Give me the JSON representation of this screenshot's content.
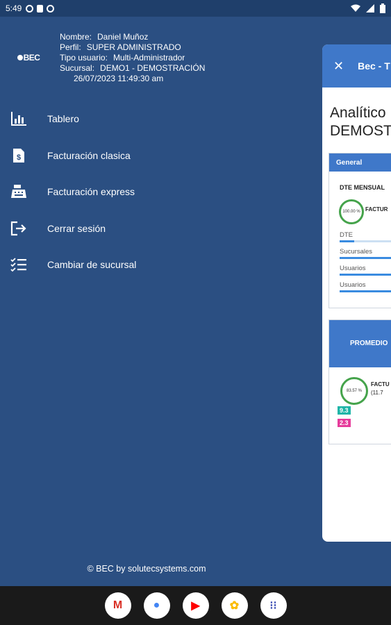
{
  "status_bar": {
    "time": "5:49",
    "icons": [
      "sync-icon",
      "sim-icon",
      "sync-icon",
      "wifi-icon",
      "signal-icon",
      "battery-icon"
    ]
  },
  "drawer": {
    "logo_text": "BEC",
    "user": {
      "name_label": "Nombre:",
      "name_value": "Daniel Muñoz",
      "profile_label": "Perfil:",
      "profile_value": "SUPER ADMINISTRADO",
      "type_label": "Tipo usuario:",
      "type_value": "Multi-Administrador",
      "branch_label": "Sucursal:",
      "branch_value": "DEMO1 - DEMOSTRACIÓN",
      "datetime": "26/07/2023 11:49:30 am"
    },
    "menu": [
      {
        "label": "Tablero",
        "icon": "bar-chart-icon"
      },
      {
        "label": "Facturación clasica",
        "icon": "invoice-icon"
      },
      {
        "label": "Facturación express",
        "icon": "cash-register-icon"
      },
      {
        "label": "Cerrar sesión",
        "icon": "logout-icon"
      },
      {
        "label": "Cambiar de sucursal",
        "icon": "checklist-icon"
      }
    ],
    "footer": "© BEC by solutecsystems.com"
  },
  "peek": {
    "close_icon": "close-icon",
    "title": "Bec - T",
    "heading_line1": "Analítico",
    "heading_line2": "DEMOST",
    "card1": {
      "header": "General",
      "subtitle": "DTE MENSUAL",
      "gauge_value": "100.00 %",
      "gauge_label": "FACTUR",
      "bars": [
        {
          "label": "DTE",
          "fill": 0.2
        },
        {
          "label": "Sucursales",
          "fill": 1.0
        },
        {
          "label": "Usuarios",
          "fill": 1.0
        },
        {
          "label": "Usuarios",
          "fill": 1.0
        }
      ]
    },
    "card2": {
      "header": "PROMEDIO",
      "gauge_value": "83.57 %",
      "gauge_label": "FACTU",
      "gauge_sub": "(11.7",
      "tag1": "9.3",
      "tag2": "2.3",
      "tag1_color": "#1fb5a8",
      "tag2_color": "#e63b9b"
    }
  },
  "nav_apps": [
    {
      "name": "gmail",
      "glyph": "M",
      "color": "#d93025"
    },
    {
      "name": "chrome",
      "glyph": "●",
      "color": "#4285f4"
    },
    {
      "name": "youtube",
      "glyph": "▶",
      "color": "#ff0000"
    },
    {
      "name": "photos",
      "glyph": "✿",
      "color": "#fbbc04"
    },
    {
      "name": "apps",
      "glyph": "⁝⁝",
      "color": "#3f51b5"
    }
  ]
}
